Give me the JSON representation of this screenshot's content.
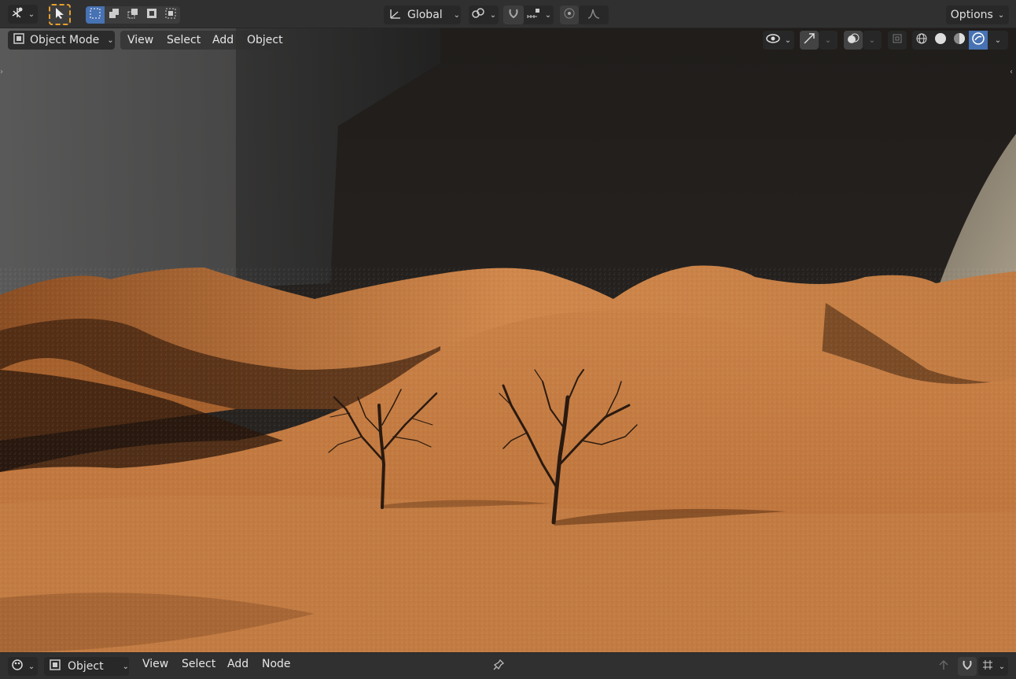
{
  "header": {
    "transform_orientation": "Global",
    "options_label": "Options"
  },
  "viewport_header": {
    "mode_label": "Object Mode",
    "menus": [
      "View",
      "Select",
      "Add",
      "Object"
    ]
  },
  "bottom_header": {
    "editor_context": "Object",
    "menus": [
      "View",
      "Select",
      "Add",
      "Node"
    ]
  },
  "colors": {
    "active_button": "#4772b3",
    "header_bg": "#303030",
    "sand": "#c4773e",
    "sky": "#1f1c1a"
  },
  "icons": {
    "editor_type": "transform-gizmo-icon",
    "select_tool": "cursor-arrow-icon",
    "pivot": "pivot-point-icon",
    "snap": "magnet-icon",
    "proportional": "proportional-edit-icon",
    "shading_modes": [
      "wireframe-icon",
      "solid-icon",
      "material-preview-icon",
      "rendered-icon"
    ]
  }
}
